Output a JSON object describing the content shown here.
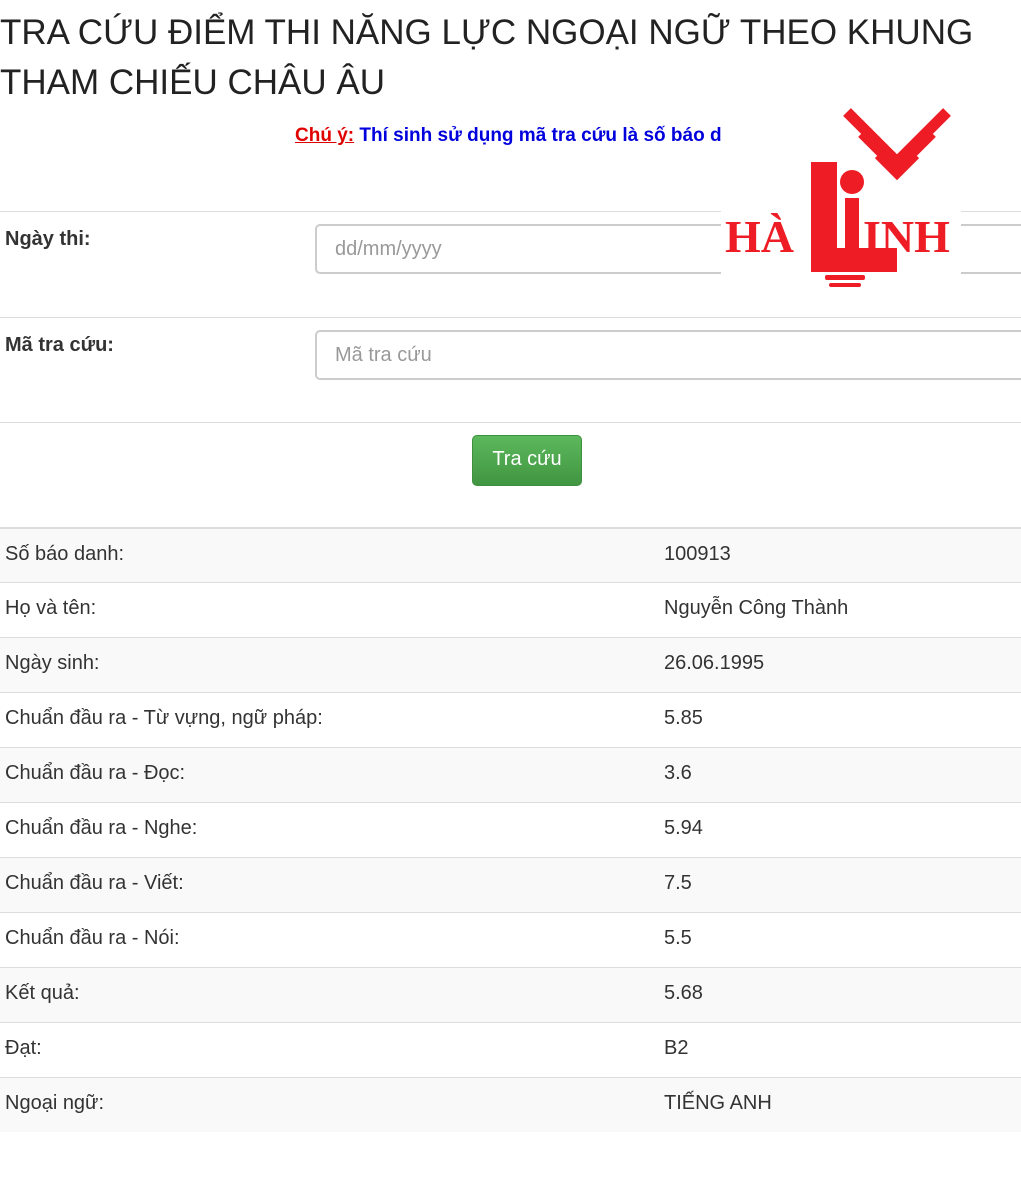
{
  "title": "TRA CỨU ĐIỂM THI NĂNG LỰC NGOẠI NGỮ THEO KHUNG THAM CHIẾU CHÂU ÂU",
  "notice": {
    "label": "Chú ý:",
    "text": "Thí sinh sử dụng mã tra cứu là số báo danh để tra cứu điểm thi"
  },
  "logo": {
    "text_left": "HÀ",
    "text_right": "INH",
    "colors": {
      "primary": "#ee1c25"
    }
  },
  "form": {
    "date_label": "Ngày thi:",
    "date_placeholder": "dd/mm/yyyy",
    "code_label": "Mã tra cứu:",
    "code_placeholder": "Mã tra cứu",
    "submit_label": "Tra cứu"
  },
  "results": [
    {
      "label": "Số báo danh:",
      "value": "100913"
    },
    {
      "label": "Họ và tên:",
      "value": "Nguyễn Công Thành"
    },
    {
      "label": "Ngày sinh:",
      "value": "26.06.1995"
    },
    {
      "label": "Chuẩn đầu ra - Từ vựng, ngữ pháp:",
      "value": "5.85"
    },
    {
      "label": "Chuẩn đầu ra - Đọc:",
      "value": "3.6"
    },
    {
      "label": "Chuẩn đầu ra - Nghe:",
      "value": "5.94"
    },
    {
      "label": "Chuẩn đầu ra - Viết:",
      "value": "7.5"
    },
    {
      "label": "Chuẩn đầu ra - Nói:",
      "value": "5.5"
    },
    {
      "label": "Kết quả:",
      "value": "5.68"
    },
    {
      "label": "Đạt:",
      "value": "B2"
    },
    {
      "label": "Ngoại ngữ:",
      "value": "TIẾNG ANH"
    }
  ],
  "colors": {
    "button": "#5cb85c",
    "notice_label": "#e00000",
    "notice_text": "#0000dd"
  }
}
